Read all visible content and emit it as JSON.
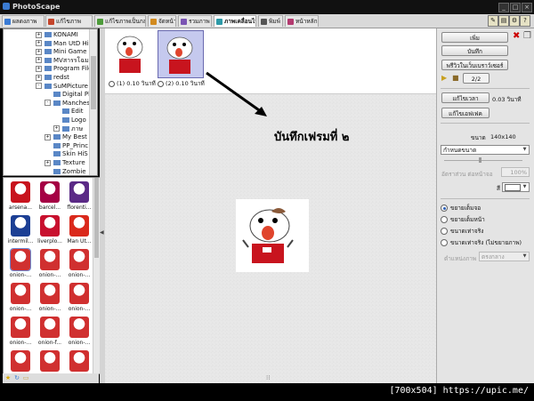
{
  "window": {
    "title": "PhotoScape"
  },
  "tabs": [
    {
      "label": "ผลดงภาพ",
      "color": "#3a7bd5",
      "active": false
    },
    {
      "label": "แก้ไขภาพ",
      "color": "#c4452b",
      "active": false
    },
    {
      "label": "แก้ไขภาพเป็นกลุ่ม",
      "color": "#4d9b3a",
      "active": false
    },
    {
      "label": "จัดหน้า",
      "color": "#d28a1e",
      "active": false
    },
    {
      "label": "รวมภาพ",
      "color": "#7a54b3",
      "active": false
    },
    {
      "label": "ภาพเคลื่อนไหว",
      "color": "#2d9aa8",
      "active": true
    },
    {
      "label": "พิมพ์",
      "color": "#555555",
      "active": false
    },
    {
      "label": "หน้าหลัก",
      "color": "#b33a6f",
      "active": false
    }
  ],
  "tree": [
    {
      "label": "KONAMI",
      "level": 0,
      "expander": "+"
    },
    {
      "label": "Man UtD Hiçi",
      "level": 0,
      "expander": "+"
    },
    {
      "label": "Mini Game",
      "level": 0,
      "expander": "+"
    },
    {
      "label": "MVสารรโฉม",
      "level": 0,
      "expander": "+"
    },
    {
      "label": "Program File",
      "level": 0,
      "expander": "+"
    },
    {
      "label": "redst",
      "level": 0,
      "expander": "+"
    },
    {
      "label": "SuMPicture",
      "level": 0,
      "expander": "-"
    },
    {
      "label": "Digital Pl",
      "level": 1,
      "expander": ""
    },
    {
      "label": "Manches",
      "level": 1,
      "expander": "-"
    },
    {
      "label": "Edit",
      "level": 2,
      "expander": ""
    },
    {
      "label": "Logo",
      "level": 2,
      "expander": ""
    },
    {
      "label": "ภาษ",
      "level": 2,
      "expander": "+"
    },
    {
      "label": "My Best",
      "level": 1,
      "expander": "+"
    },
    {
      "label": "PP_Princ",
      "level": 1,
      "expander": ""
    },
    {
      "label": "Skin HiS",
      "level": 1,
      "expander": ""
    },
    {
      "label": "Texture",
      "level": 1,
      "expander": "+"
    },
    {
      "label": "Zombie",
      "level": 1,
      "expander": ""
    }
  ],
  "thumbnails": [
    {
      "caption": "arsena...",
      "color": "#c8141e",
      "selected": false
    },
    {
      "caption": "barcel...",
      "color": "#a50044",
      "selected": false
    },
    {
      "caption": "florenti...",
      "color": "#5b2a86",
      "selected": false
    },
    {
      "caption": "intermil...",
      "color": "#1c3f94",
      "selected": false
    },
    {
      "caption": "liverplo...",
      "color": "#c8102e",
      "selected": false
    },
    {
      "caption": "Man Ut...",
      "color": "#da291c",
      "selected": false
    },
    {
      "caption": "onion-...",
      "color": "#d03030",
      "selected": true
    },
    {
      "caption": "onion-...",
      "color": "#d03030",
      "selected": false
    },
    {
      "caption": "onion-...",
      "color": "#d03030",
      "selected": false
    },
    {
      "caption": "onion-...",
      "color": "#d03030",
      "selected": false
    },
    {
      "caption": "onion-...",
      "color": "#d03030",
      "selected": false
    },
    {
      "caption": "onion-...",
      "color": "#d03030",
      "selected": false
    },
    {
      "caption": "onion-...",
      "color": "#d03030",
      "selected": false
    },
    {
      "caption": "onion-f...",
      "color": "#d03030",
      "selected": false
    },
    {
      "caption": "onion-...",
      "color": "#d03030",
      "selected": false
    },
    {
      "caption": "",
      "color": "#d03030",
      "selected": false
    },
    {
      "caption": "",
      "color": "#d03030",
      "selected": false
    },
    {
      "caption": "",
      "color": "#d03030",
      "selected": false
    }
  ],
  "frames": [
    {
      "label": "(1) 0.10 วินาที",
      "selected": false
    },
    {
      "label": "(2) 0.10 วินาที",
      "selected": true
    }
  ],
  "annotation": "บันทึกเฟรมที่ ๒",
  "right_panel": {
    "add_label": "เพิ่ม",
    "save_label": "บันทึก",
    "preview_browser_label": "พรีวิวในเว็บเบราว์เซอร์",
    "frame_counter": "2/2",
    "change_time_label": "แก้ไขเวลา",
    "time_value": "0.03 วินาที",
    "change_effect_label": "แก้ไขเอฟเฟค",
    "size_label": "ขนาด",
    "size_value": "140x140",
    "size_preset": "กำหนดขนาด",
    "ratio_label": "อัตราส่วน ต่อหน้าจอ",
    "ratio_value": "100%",
    "color_label": "สี",
    "radio_options": [
      {
        "label": "ขยายเต็มจอ",
        "checked": true
      },
      {
        "label": "ขยายเต็มหน้า",
        "checked": false
      },
      {
        "label": "ขนาดเท่าจริง",
        "checked": false
      },
      {
        "label": "ขนาดเท่าจริง (ไม่ขยายภาพ)",
        "checked": false
      }
    ],
    "position_label": "ตำแหน่งภาพ",
    "position_value": "ตรงกลาง"
  },
  "watermark": "[700x504] https://upic.me/"
}
